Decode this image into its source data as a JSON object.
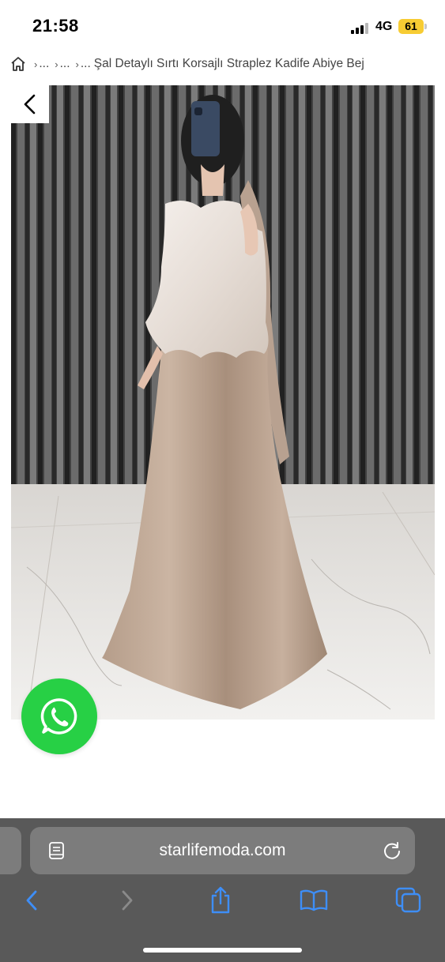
{
  "status_bar": {
    "time": "21:58",
    "network": "4G",
    "battery": "61",
    "icons": [
      "signal-icon",
      "battery-icon"
    ]
  },
  "breadcrumb": {
    "home_icon": "home-icon",
    "crumbs": [
      "...",
      "...",
      "..."
    ],
    "current": "Şal Detaylı Sırtı Korsajlı Straplez Kadife Abiye Bej"
  },
  "product": {
    "image_icon": "evening-dress-photo",
    "back_icon": "chevron-left-icon"
  },
  "whatsapp": {
    "icon": "whatsapp-icon",
    "color": "#27d045"
  },
  "safari": {
    "url": "starlifemoda.com",
    "icons": [
      "reader-mode-icon",
      "reload-icon",
      "back-icon",
      "forward-icon",
      "share-icon",
      "bookmarks-icon",
      "tabs-icon"
    ],
    "accent": "#3e8ef7",
    "bar_color": "#595959"
  }
}
